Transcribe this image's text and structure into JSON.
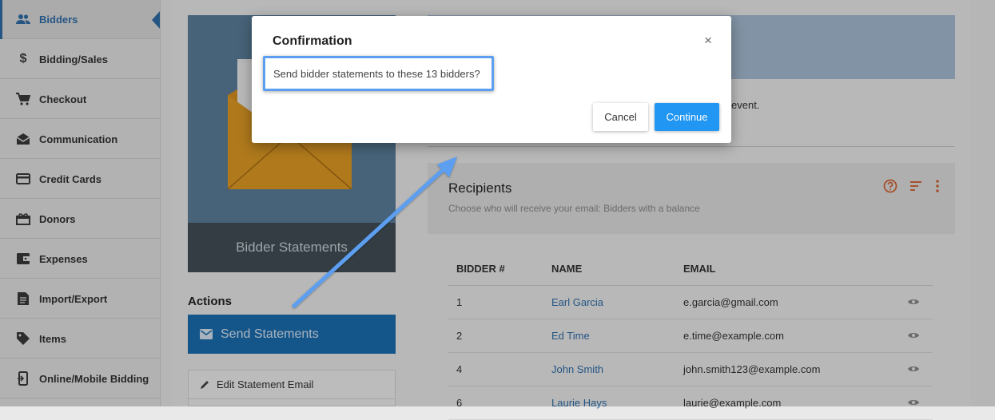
{
  "sidebar": {
    "items": [
      {
        "label": "Bidders",
        "icon": "people-icon",
        "active": true
      },
      {
        "label": "Bidding/Sales",
        "icon": "dollar-icon"
      },
      {
        "label": "Checkout",
        "icon": "cart-icon"
      },
      {
        "label": "Communication",
        "icon": "envelope-open-icon"
      },
      {
        "label": "Credit Cards",
        "icon": "credit-card-icon"
      },
      {
        "label": "Donors",
        "icon": "gift-icon"
      },
      {
        "label": "Expenses",
        "icon": "wallet-icon"
      },
      {
        "label": "Import/Export",
        "icon": "document-icon"
      },
      {
        "label": "Items",
        "icon": "tag-icon"
      },
      {
        "label": "Online/Mobile Bidding",
        "icon": "mobile-icon"
      }
    ]
  },
  "left_panel": {
    "hero_caption": "Bidder Statements",
    "actions_title": "Actions",
    "send_button": "Send Statements",
    "edit_email": "Edit Statement Email"
  },
  "right_panel": {
    "description_tail": "event.",
    "recipients": {
      "title": "Recipients",
      "subtitle": "Choose who will receive your email: Bidders with a balance"
    },
    "table": {
      "headers": [
        "BIDDER #",
        "NAME",
        "EMAIL"
      ],
      "rows": [
        {
          "number": "1",
          "name": "Earl Garcia",
          "email": "e.garcia@gmail.com"
        },
        {
          "number": "2",
          "name": "Ed Time",
          "email": "e.time@example.com"
        },
        {
          "number": "4",
          "name": "John Smith",
          "email": "john.smith123@example.com"
        },
        {
          "number": "6",
          "name": "Laurie Hays",
          "email": "laurie@example.com"
        }
      ]
    }
  },
  "modal": {
    "title": "Confirmation",
    "close_glyph": "×",
    "message": "Send bidder statements to these 13 bidders?",
    "cancel_label": "Cancel",
    "continue_label": "Continue"
  },
  "colors": {
    "accent": "#2196f3",
    "sidebar_active": "#2f6ea8",
    "send_button": "#1b6fb1",
    "annotation": "#5c9ef0"
  }
}
